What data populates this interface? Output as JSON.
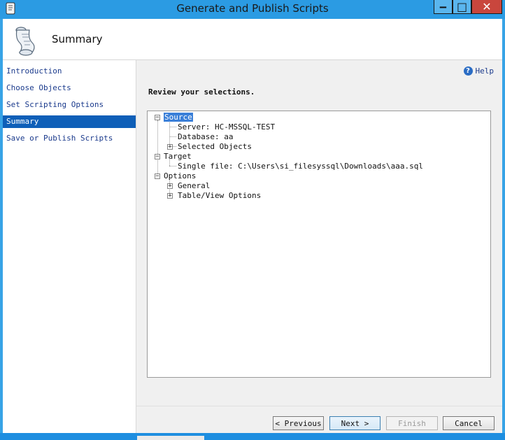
{
  "window": {
    "title": "Generate and Publish Scripts"
  },
  "header": {
    "title": "Summary",
    "icon": "scroll-icon"
  },
  "sidebar": {
    "items": [
      {
        "label": "Introduction",
        "active": false
      },
      {
        "label": "Choose Objects",
        "active": false
      },
      {
        "label": "Set Scripting Options",
        "active": false
      },
      {
        "label": "Summary",
        "active": true
      },
      {
        "label": "Save or Publish Scripts",
        "active": false
      }
    ]
  },
  "main": {
    "help_label": "Help",
    "review_text": "Review your selections.",
    "tree": {
      "source": {
        "label": "Source",
        "server": "Server: HC-MSSQL-TEST",
        "database": "Database: aa",
        "selected_objects": "Selected Objects"
      },
      "target": {
        "label": "Target",
        "single_file": "Single file: C:\\Users\\si_filesyssql\\Downloads\\aaa.sql"
      },
      "options": {
        "label": "Options",
        "general": "General",
        "table_view": "Table/View Options"
      }
    }
  },
  "buttons": {
    "previous": "< Previous",
    "next": "Next >",
    "finish": "Finish",
    "cancel": "Cancel"
  },
  "colors": {
    "titlebar": "#2b9be3",
    "active_nav": "#0e5fb8",
    "close_button": "#c9463d"
  }
}
